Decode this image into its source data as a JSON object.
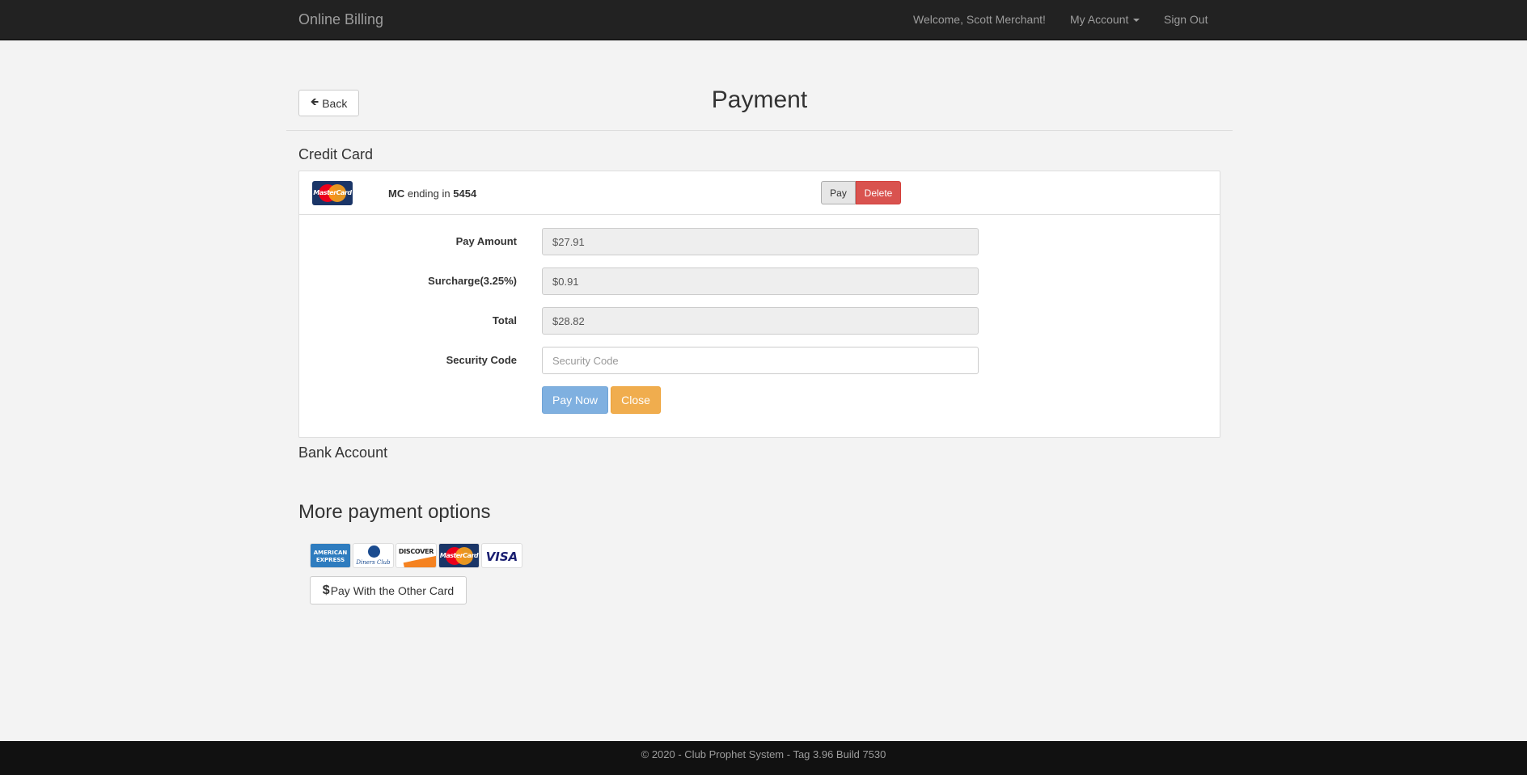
{
  "navbar": {
    "brand": "Online Billing",
    "welcome": "Welcome, Scott Merchant!",
    "my_account": "My Account",
    "sign_out": "Sign Out"
  },
  "header": {
    "back_label": "Back",
    "title": "Payment"
  },
  "sections": {
    "credit_card": "Credit Card",
    "bank_account": "Bank Account",
    "more_options": "More payment options"
  },
  "card": {
    "brand_logo": "MasterCard",
    "type": "MC",
    "ending_text": "ending in",
    "last4": "5454",
    "pay_label": "Pay",
    "delete_label": "Delete"
  },
  "form": {
    "pay_amount_label": "Pay Amount",
    "pay_amount_value": "$27.91",
    "surcharge_label": "Surcharge(3.25%)",
    "surcharge_value": "$0.91",
    "total_label": "Total",
    "total_value": "$28.82",
    "security_label": "Security Code",
    "security_value": "",
    "security_placeholder": "Security Code",
    "pay_now_label": "Pay Now",
    "close_label": "Close"
  },
  "more_options": {
    "logos": {
      "amex_line1": "AMERICAN",
      "amex_line2": "EXPRESS",
      "diners": "Diners Club",
      "discover": "DISCOVER",
      "mastercard": "MasterCard",
      "visa": "VISA"
    },
    "other_card_label": "Pay With the Other Card"
  },
  "footer": {
    "text": "© 2020 - Club Prophet System - Tag 3.96 Build 7530"
  },
  "colors": {
    "navbar_bg": "#222222",
    "delete_red": "#d9534f",
    "pay_now_blue": "#7fb0e0",
    "close_orange": "#f0ad4e"
  }
}
